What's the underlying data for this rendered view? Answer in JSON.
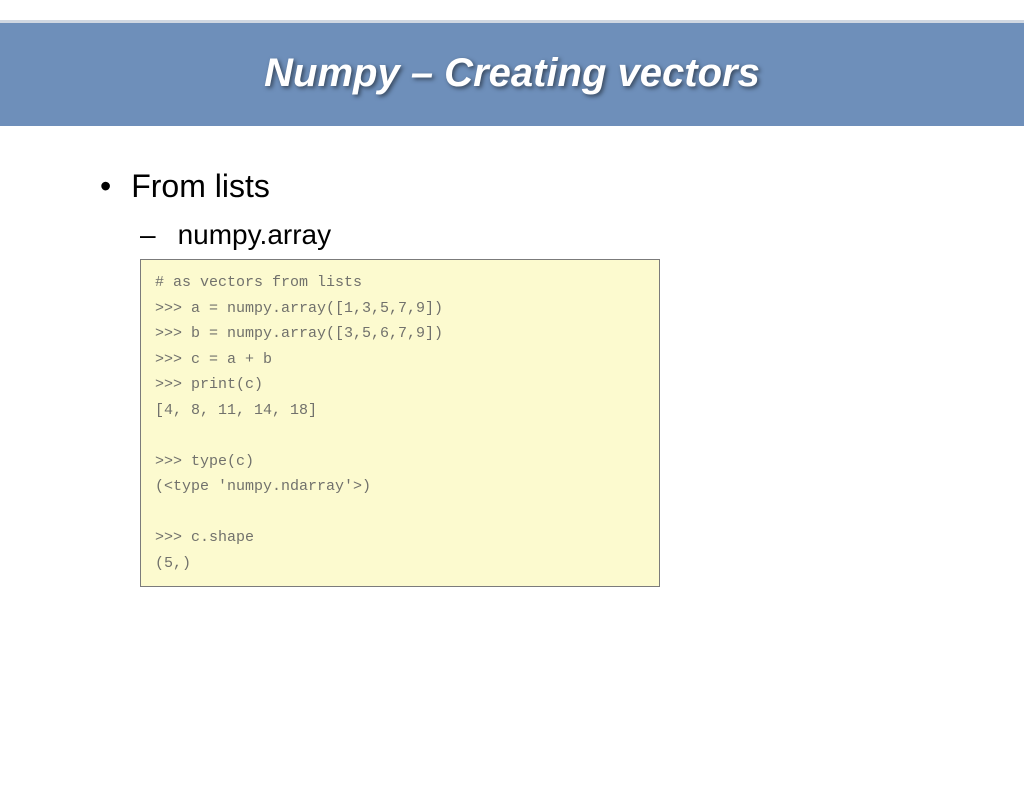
{
  "slide": {
    "title": "Numpy – Creating vectors",
    "bullet1": "From lists",
    "bullet1_sub1": "numpy.array",
    "code": "# as vectors from lists\n>>> a = numpy.array([1,3,5,7,9])\n>>> b = numpy.array([3,5,6,7,9])\n>>> c = a + b\n>>> print(c)\n[4, 8, 11, 14, 18]\n\n>>> type(c)\n(<type 'numpy.ndarray'>)\n\n>>> c.shape\n(5,)"
  }
}
